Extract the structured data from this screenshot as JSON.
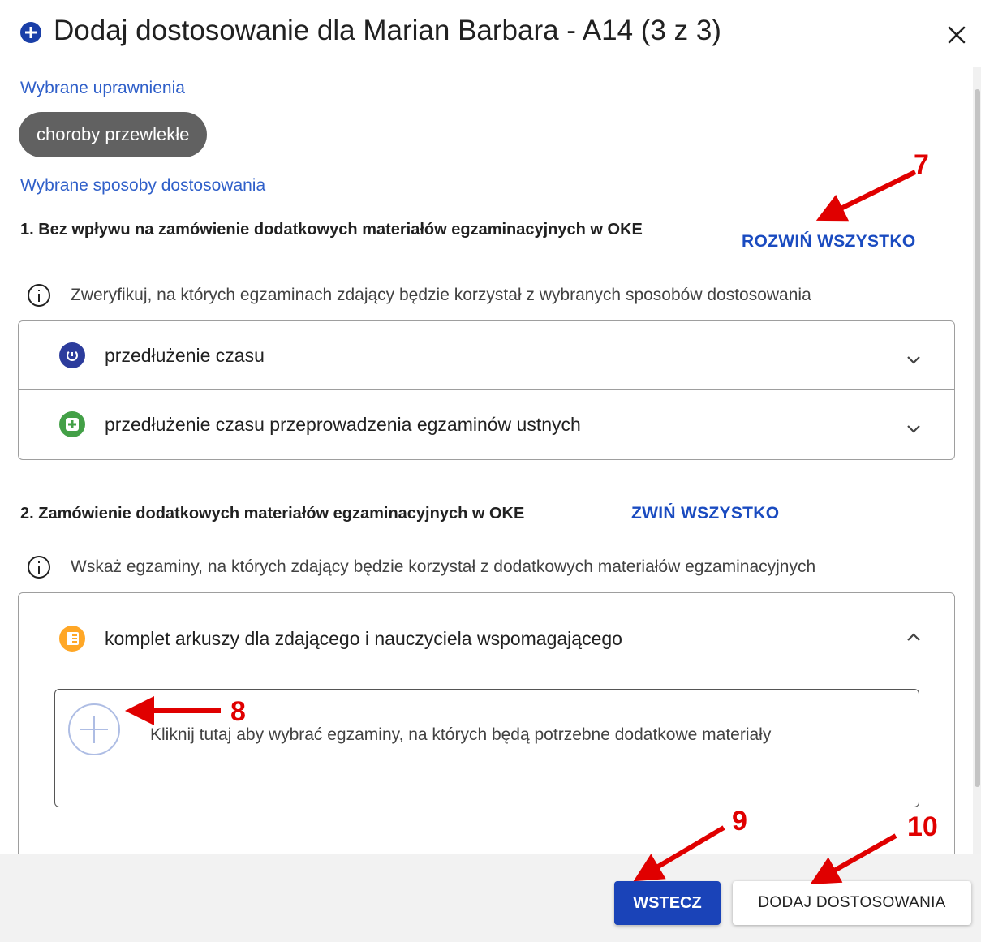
{
  "dialog": {
    "title": "Dodaj dostosowanie dla Marian Barbara - A14 (3 z 3)"
  },
  "selected_rights": {
    "label": "Wybrane uprawnienia",
    "chips": [
      "choroby przewlekłe"
    ]
  },
  "selected_methods": {
    "label": "Wybrane sposoby dostosowania"
  },
  "section1": {
    "heading": "1. Bez wpływu na zamówienie dodatkowych materiałów egzaminacyjnych w OKE",
    "action": "ROZWIŃ WSZYSTKO",
    "info": "Zweryfikuj, na których egzaminach zdający będzie korzystał z wybranych sposobów dostosowania",
    "items": [
      {
        "label": "przedłużenie czasu",
        "icon": "clock-icon",
        "expanded": false
      },
      {
        "label": "przedłużenie czasu przeprowadzenia egzaminów ustnych",
        "icon": "plus-square-icon",
        "expanded": false
      }
    ]
  },
  "section2": {
    "heading": "2. Zamówienie dodatkowych materiałów egzaminacyjnych w OKE",
    "action": "ZWIŃ WSZYSTKO",
    "info": "Wskaż egzaminy, na których zdający będzie korzystał z dodatkowych materiałów egzaminacyjnych",
    "items": [
      {
        "label": "komplet arkuszy dla zdającego i nauczyciela wspomagającego",
        "icon": "document-icon",
        "expanded": true,
        "dropzone_text": "Kliknij tutaj aby wybrać egzaminy, na których będą potrzebne dodatkowe materiały"
      }
    ]
  },
  "footer": {
    "back_label": "WSTECZ",
    "add_label": "DODAJ DOSTOSOWANIA"
  },
  "callouts": [
    "7",
    "8",
    "9",
    "10"
  ],
  "colors": {
    "primary": "#1a43b8",
    "link": "#2f5fc9",
    "chip": "#616161",
    "callout": "#e00000"
  }
}
